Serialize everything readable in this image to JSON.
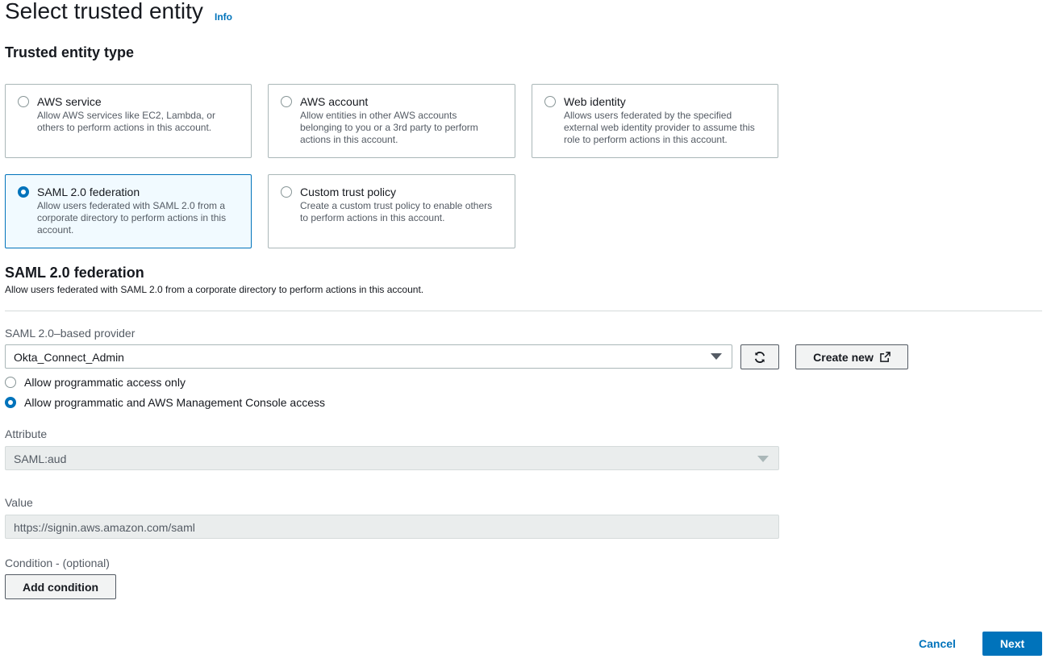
{
  "header": {
    "title": "Select trusted entity",
    "info": "Info"
  },
  "entity_type": {
    "heading": "Trusted entity type",
    "options": [
      {
        "label": "AWS service",
        "description": "Allow AWS services like EC2, Lambda, or others to perform actions in this account.",
        "selected": false
      },
      {
        "label": "AWS account",
        "description": "Allow entities in other AWS accounts belonging to you or a 3rd party to perform actions in this account.",
        "selected": false
      },
      {
        "label": "Web identity",
        "description": "Allows users federated by the specified external web identity provider to assume this role to perform actions in this account.",
        "selected": false
      },
      {
        "label": "SAML 2.0 federation",
        "description": "Allow users federated with SAML 2.0 from a corporate directory to perform actions in this account.",
        "selected": true
      },
      {
        "label": "Custom trust policy",
        "description": "Create a custom trust policy to enable others to perform actions in this account.",
        "selected": false
      }
    ]
  },
  "saml": {
    "heading": "SAML 2.0 federation",
    "description": "Allow users federated with SAML 2.0 from a corporate directory to perform actions in this account.",
    "provider_label": "SAML 2.0–based provider",
    "provider_value": "Okta_Connect_Admin",
    "create_new_label": "Create new",
    "access_options": [
      {
        "label": "Allow programmatic access only",
        "selected": false
      },
      {
        "label": "Allow programmatic and AWS Management Console access",
        "selected": true
      }
    ],
    "attribute_label": "Attribute",
    "attribute_value": "SAML:aud",
    "value_label": "Value",
    "value_value": "https://signin.aws.amazon.com/saml",
    "condition_label": "Condition - (optional)",
    "add_condition_label": "Add condition"
  },
  "footer": {
    "cancel_label": "Cancel",
    "next_label": "Next"
  },
  "colors": {
    "accent": "#0073bb",
    "selected_tile_bg": "#f1faff"
  }
}
